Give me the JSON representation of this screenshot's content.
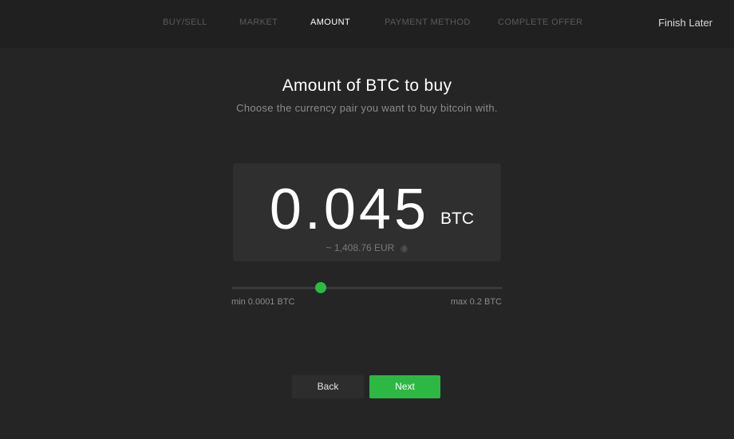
{
  "steps": [
    {
      "label": "BUY/SELL",
      "active": false
    },
    {
      "label": "MARKET",
      "active": false
    },
    {
      "label": "AMOUNT",
      "active": true
    },
    {
      "label": "PAYMENT METHOD",
      "active": false
    },
    {
      "label": "COMPLETE OFFER",
      "active": false
    }
  ],
  "header": {
    "finish_label": "Finish Later"
  },
  "main": {
    "title": "Amount of BTC to buy",
    "subtitle": "Choose the currency pair you want to buy bitcoin with."
  },
  "amount": {
    "value": "0.045",
    "unit": "BTC",
    "fiat": "~ 1,408.76 EUR",
    "info_icon": "info-icon"
  },
  "slider": {
    "min_label": "min 0.0001 BTC",
    "max_label": "max 0.2 BTC",
    "position_fraction": 0.33
  },
  "buttons": {
    "back_label": "Back",
    "next_label": "Next"
  },
  "colors": {
    "accent": "#2db843",
    "background": "#252525",
    "topbar": "#202020"
  }
}
